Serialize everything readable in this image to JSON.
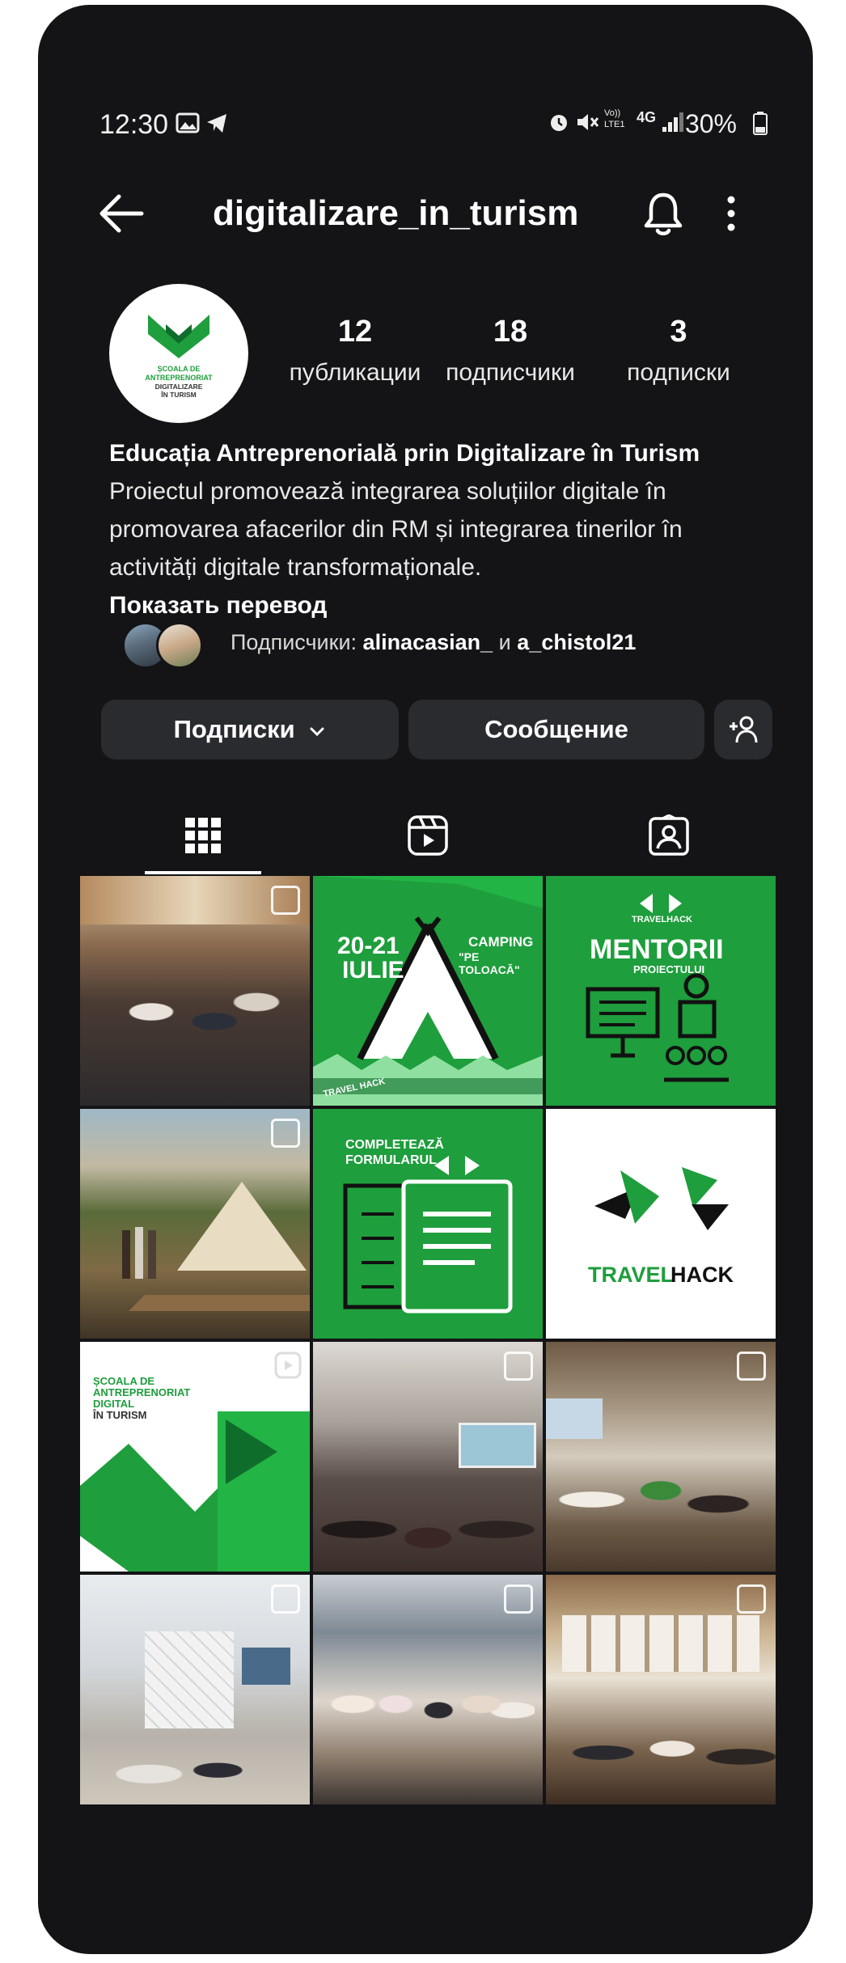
{
  "status_bar": {
    "time": "12:30",
    "battery": "30%",
    "network": "4G",
    "volte": "Vo)) LTE1"
  },
  "header": {
    "username": "digitalizare_in_turism",
    "icons": [
      "back-arrow-icon",
      "bell-icon",
      "more-vertical-icon"
    ]
  },
  "profile": {
    "avatar_text": "ȘCOALA DE ANTREPRENORIAT DIGITALIZARE ÎN TURISM",
    "stats": [
      {
        "value": "12",
        "label": "публикации"
      },
      {
        "value": "18",
        "label": "подписчики"
      },
      {
        "value": "3",
        "label": "подписки"
      }
    ],
    "name": "Educația Antreprenorială prin Digitalizare în Turism",
    "bio_lines": [
      "Proiectul promovează integrarea soluțiilor digitale în",
      "promovarea afacerilor din RM și integrarea tinerilor în",
      "activități digitale transformaționale."
    ],
    "translate_link": "Показать перевод",
    "followers_prefix": "Подписчики:",
    "follower_1": "alinacasian_",
    "follower_join": "и",
    "follower_2": "a_chistol21"
  },
  "actions": {
    "following_label": "Подписки",
    "message_label": "Сообщение",
    "add_user_icon": "add-person-icon"
  },
  "tabs": [
    {
      "name": "grid",
      "icon": "grid-icon",
      "active": true
    },
    {
      "name": "reels",
      "icon": "reels-icon",
      "active": false
    },
    {
      "name": "tagged",
      "icon": "tagged-icon",
      "active": false
    }
  ],
  "posts": [
    {
      "kind": "photo",
      "multi": true
    },
    {
      "kind": "graphic",
      "date": "20-21",
      "month": "IULIE",
      "event": "CAMPING",
      "place": "\"PE TOLOACĂ\"",
      "tape": "TRAVEL HACK"
    },
    {
      "kind": "graphic",
      "brand": "TRAVELHACK",
      "headline": "MENTORII",
      "sub": "PROIECTULUI"
    },
    {
      "kind": "photo",
      "multi": true
    },
    {
      "kind": "graphic",
      "headline": "COMPLETEAZĂ",
      "sub": "FORMULARUL"
    },
    {
      "kind": "logo",
      "travel": "TRAVEL",
      "hack": "HACK"
    },
    {
      "kind": "reel",
      "lines": [
        "ȘCOALA DE",
        "ANTREPRENORIAT",
        "DIGITAL"
      ],
      "last": "ÎN TURISM"
    },
    {
      "kind": "photo",
      "multi": true
    },
    {
      "kind": "photo",
      "multi": true
    },
    {
      "kind": "photo",
      "multi": true
    },
    {
      "kind": "photo",
      "multi": true
    },
    {
      "kind": "photo",
      "multi": true
    }
  ],
  "colors": {
    "background": "#141416",
    "button": "#2a2b2f",
    "brand_green": "#1e9e3c",
    "brand_dark_green": "#0f6d2b"
  }
}
